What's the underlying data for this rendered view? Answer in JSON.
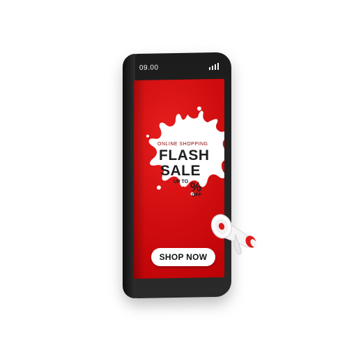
{
  "status_bar": {
    "time": "09.00",
    "signal_icon": "signal-bars-icon"
  },
  "promo": {
    "kicker": "ONLINE SHOPPING",
    "headline_line1": "FLASH",
    "headline_line2": "SALE",
    "up_to": "UP TO",
    "discount": "70",
    "percent_sign": "%",
    "off": "OFF"
  },
  "cta": {
    "label": "SHOP NOW"
  },
  "decor": {
    "megaphone_icon": "megaphone-icon",
    "splash_icon": "splash-burst-icon"
  },
  "colors": {
    "screen_red": "#d10e10",
    "phone_body": "#1c1c1c",
    "accent_red": "#e20e0e",
    "text_dark": "#1e1e1e"
  }
}
